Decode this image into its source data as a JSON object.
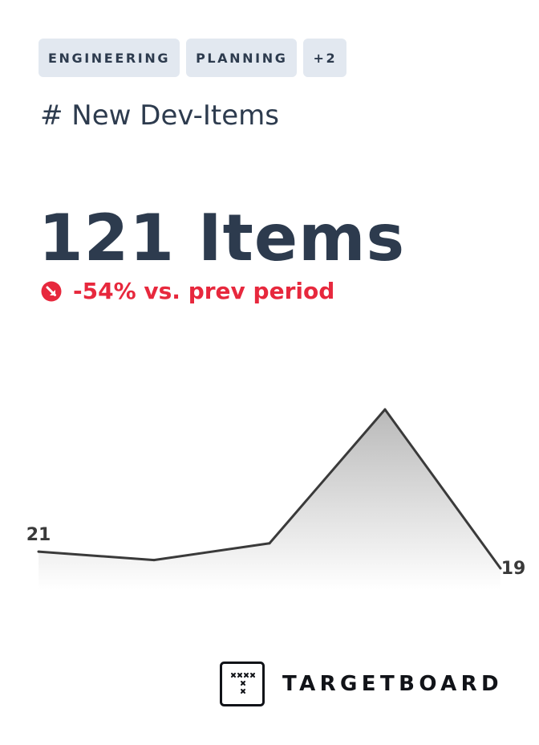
{
  "tags": [
    {
      "label": "ENGINEERING"
    },
    {
      "label": "PLANNING"
    },
    {
      "label": "+2"
    }
  ],
  "metric": {
    "title": "# New Dev-Items",
    "value": "121 Items",
    "change_text": "-54% vs. prev period",
    "change_icon": "trend-down-circle-icon",
    "change_color": "#e7283d"
  },
  "colors": {
    "text_primary": "#2d3b4e",
    "tag_bg": "#e2e8f0",
    "negative": "#e7283d",
    "line": "#3a3a3a"
  },
  "chart_data": {
    "type": "area",
    "x": [
      1,
      2,
      3,
      4,
      5
    ],
    "values": [
      21,
      20,
      22,
      38,
      19
    ],
    "labels": [
      "21",
      "",
      "",
      "",
      "19"
    ],
    "ylim": [
      19,
      38
    ],
    "grid": false,
    "legend": "none"
  },
  "brand": {
    "name": "TARGETBOARD",
    "icon": "targetboard-logo-icon"
  }
}
